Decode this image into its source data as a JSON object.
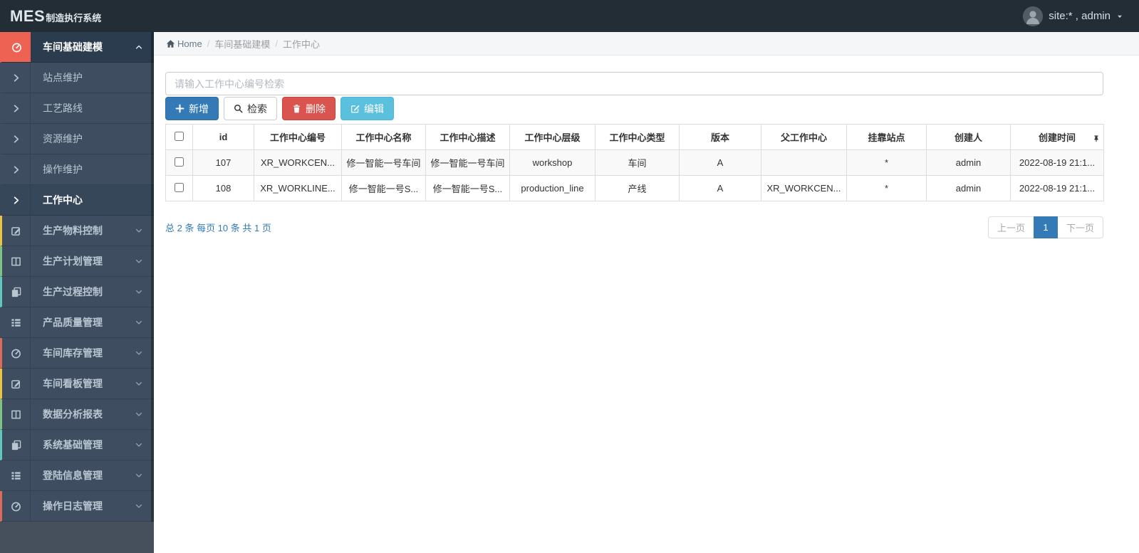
{
  "app": {
    "brand_bold": "MES",
    "brand_rest": "制造执行系统",
    "user_label": "site:* , admin",
    "avatar_icon": "person-icon",
    "caret_icon": "caret-down-icon"
  },
  "breadcrumb": {
    "home_icon": "home-icon",
    "home": "Home",
    "items": [
      "车间基础建模",
      "工作中心"
    ]
  },
  "sidebar": {
    "items": [
      {
        "name": "sidebar-item-workshop-modeling",
        "label": "车间基础建模",
        "icon": "gauge-icon",
        "type": "parent",
        "state": "active-parent",
        "arrow": "chevron-up-icon",
        "accent": "#ee6253"
      },
      {
        "name": "sidebar-item-station-maintenance",
        "label": "站点维护",
        "icon": "chevron-right-icon",
        "type": "sub",
        "state": "",
        "arrow": "",
        "accent": ""
      },
      {
        "name": "sidebar-item-process-route",
        "label": "工艺路线",
        "icon": "chevron-right-icon",
        "type": "sub",
        "state": "",
        "arrow": "",
        "accent": ""
      },
      {
        "name": "sidebar-item-resource-maintenance",
        "label": "资源维护",
        "icon": "chevron-right-icon",
        "type": "sub",
        "state": "",
        "arrow": "",
        "accent": ""
      },
      {
        "name": "sidebar-item-operation-maintenance",
        "label": "操作维护",
        "icon": "chevron-right-icon",
        "type": "sub",
        "state": "",
        "arrow": "",
        "accent": ""
      },
      {
        "name": "sidebar-item-work-center",
        "label": "工作中心",
        "icon": "chevron-right-icon",
        "type": "sub",
        "state": "active-sub",
        "arrow": "",
        "accent": ""
      },
      {
        "name": "sidebar-item-material-control",
        "label": "生产物料控制",
        "icon": "pencil-square-icon",
        "type": "parent",
        "state": "",
        "arrow": "chevron-down-icon",
        "accent": "#ecc341"
      },
      {
        "name": "sidebar-item-plan-management",
        "label": "生产计划管理",
        "icon": "columns-icon",
        "type": "parent",
        "state": "",
        "arrow": "chevron-down-icon",
        "accent": "#7cc47f"
      },
      {
        "name": "sidebar-item-process-control",
        "label": "生产过程控制",
        "icon": "book-icon",
        "type": "parent",
        "state": "",
        "arrow": "chevron-down-icon",
        "accent": "#5fc6c0"
      },
      {
        "name": "sidebar-item-quality-management",
        "label": "产品质量管理",
        "icon": "list-icon",
        "type": "parent",
        "state": "",
        "arrow": "chevron-down-icon",
        "accent": ""
      },
      {
        "name": "sidebar-item-inventory-management",
        "label": "车间库存管理",
        "icon": "gauge-icon",
        "type": "parent",
        "state": "",
        "arrow": "chevron-down-icon",
        "accent": "#e06a5a"
      },
      {
        "name": "sidebar-item-kanban-management",
        "label": "车间看板管理",
        "icon": "pencil-square-icon",
        "type": "parent",
        "state": "",
        "arrow": "chevron-down-icon",
        "accent": "#ecc341"
      },
      {
        "name": "sidebar-item-data-analysis",
        "label": "数据分析报表",
        "icon": "columns-icon",
        "type": "parent",
        "state": "",
        "arrow": "chevron-down-icon",
        "accent": "#7cc47f"
      },
      {
        "name": "sidebar-item-system-management",
        "label": "系统基础管理",
        "icon": "book-icon",
        "type": "parent",
        "state": "",
        "arrow": "chevron-down-icon",
        "accent": "#5fc6c0"
      },
      {
        "name": "sidebar-item-login-info",
        "label": "登陆信息管理",
        "icon": "list-icon",
        "type": "parent",
        "state": "",
        "arrow": "chevron-down-icon",
        "accent": ""
      },
      {
        "name": "sidebar-item-operation-log",
        "label": "操作日志管理",
        "icon": "gauge-icon",
        "type": "parent",
        "state": "",
        "arrow": "chevron-down-icon",
        "accent": "#e06a5a"
      }
    ]
  },
  "search": {
    "placeholder": "请输入工作中心编号检索"
  },
  "toolbar": {
    "buttons": [
      {
        "name": "add-button",
        "label": "新增",
        "icon": "plus-icon",
        "style": "primary"
      },
      {
        "name": "search-button",
        "label": "检索",
        "icon": "search-icon",
        "style": "default"
      },
      {
        "name": "delete-button",
        "label": "删除",
        "icon": "trash-icon",
        "style": "danger"
      },
      {
        "name": "edit-button",
        "label": "编辑",
        "icon": "edit-icon",
        "style": "info"
      }
    ]
  },
  "table": {
    "pin_icon": "pin-icon",
    "columns": [
      "id",
      "工作中心编号",
      "工作中心名称",
      "工作中心描述",
      "工作中心层级",
      "工作中心类型",
      "版本",
      "父工作中心",
      "挂靠站点",
      "创建人",
      "创建时间"
    ],
    "rows": [
      [
        "107",
        "XR_WORKCEN...",
        "修一智能一号车间",
        "修一智能一号车间",
        "workshop",
        "车间",
        "A",
        "",
        "*",
        "admin",
        "2022-08-19 21:1..."
      ],
      [
        "108",
        "XR_WORKLINE...",
        "修一智能一号S...",
        "修一智能一号S...",
        "production_line",
        "产线",
        "A",
        "XR_WORKCEN...",
        "*",
        "admin",
        "2022-08-19 21:1..."
      ]
    ]
  },
  "pagination": {
    "summary": "总 2 条 每页 10 条 共 1 页",
    "prev": "上一页",
    "page": "1",
    "next": "下一页"
  },
  "colors": {
    "navbar_bg": "#222d36",
    "sidebar_bg": "#3e4e60",
    "active_icon_bg": "#ee6253",
    "primary": "#337ab7",
    "danger": "#d9534f",
    "info": "#5bc0de",
    "accent_yellow": "#ecc341",
    "accent_green": "#7cc47f",
    "accent_teal": "#5fc6c0",
    "accent_red": "#e06a5a"
  }
}
